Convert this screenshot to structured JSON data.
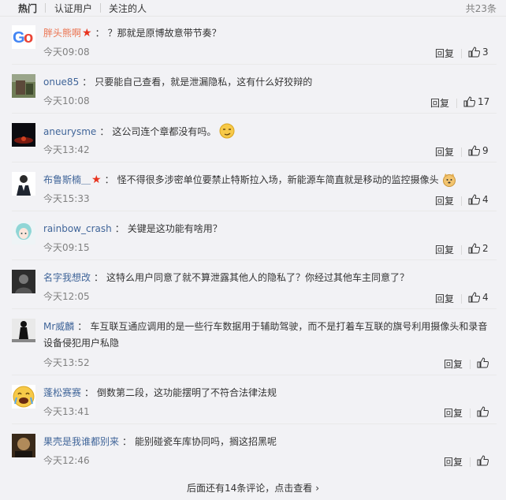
{
  "tabs": {
    "hot": "热门",
    "verified": "认证用户",
    "following": "关注的人"
  },
  "total": "共23条",
  "reply_label": "回复",
  "comments": [
    {
      "user": "胖头熊啊",
      "text": "？那就是原博故意带节奏？",
      "time": "今天09:08",
      "likes": "3",
      "badge": "star-icon"
    },
    {
      "user": "onue85",
      "text": "只要能自己查看，就是泄漏隐私，这有什么好狡辩的",
      "time": "今天10:08",
      "likes": "17"
    },
    {
      "user": "aneurysme",
      "text": "这公司连个章都没有吗。",
      "time": "今天13:42",
      "likes": "9",
      "emoji": "smirk-emoji"
    },
    {
      "user": "布鲁斯楠＿",
      "text": "怪不得很多涉密单位要禁止特斯拉入场，新能源车简直就是移动的监控摄像头",
      "time": "今天15:33",
      "likes": "4",
      "badge": "star-icon",
      "emoji": "doge-emoji"
    },
    {
      "user": "rainbow_crash",
      "text": "关键是这功能有啥用？",
      "time": "今天09:15",
      "likes": "2"
    },
    {
      "user": "名字我想改",
      "text": "这特么用户同意了就不算泄露其他人的隐私了？你经过其他车主同意了？",
      "time": "今天12:05",
      "likes": "4"
    },
    {
      "user": "Mr威麟",
      "text": "车互联互通应调用的是一些行车数据用于辅助驾驶，而不是打着车互联的旗号利用摄像头和录音设备侵犯用户私隐",
      "time": "今天13:52",
      "likes": ""
    },
    {
      "user": "蓬松赛赛",
      "text": "倒数第二段，这功能摆明了不符合法律法规",
      "time": "今天13:41",
      "likes": ""
    },
    {
      "user": "果壳是我谁都别来",
      "text": "能别碰瓷车库协同吗，搁这招黑呢",
      "time": "今天12:46",
      "likes": ""
    }
  ],
  "more": "后面还有14条评论，点击查看",
  "colors": {
    "username": "#eb7350",
    "star": "#e8331e",
    "muted": "#808080"
  }
}
